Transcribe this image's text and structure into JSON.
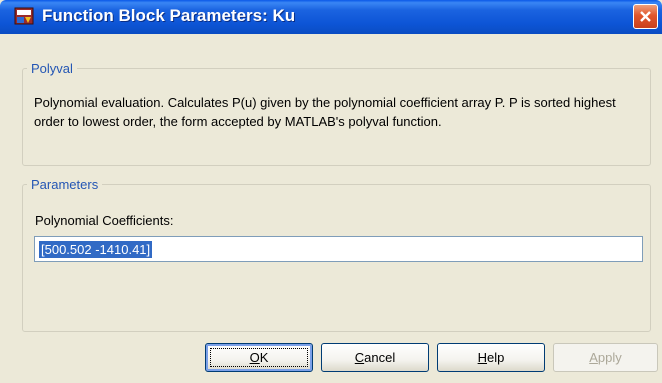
{
  "window": {
    "title": "Function Block Parameters: Ku",
    "colors": {
      "titlebar": "#0a58e8",
      "close": "#e1562c",
      "legend": "#2456b4",
      "selection": "#316ac5"
    }
  },
  "polyval_group": {
    "legend": "Polyval",
    "description": "Polynomial evaluation.  Calculates P(u) given by the polynomial coefficient array P. P is sorted highest order to lowest order, the form accepted by MATLAB's polyval function."
  },
  "parameters_group": {
    "legend": "Parameters",
    "coeff_label": "Polynomial Coefficients:",
    "coeff_value": "[500.502 -1410.41]"
  },
  "buttons": {
    "ok": {
      "mnemonic": "O",
      "rest": "K"
    },
    "cancel": {
      "mnemonic": "C",
      "rest": "ancel"
    },
    "help": {
      "mnemonic": "H",
      "rest": "elp"
    },
    "apply": {
      "mnemonic": "A",
      "rest": "pply"
    }
  },
  "icons": [
    "simulink-block-icon",
    "close-icon"
  ]
}
